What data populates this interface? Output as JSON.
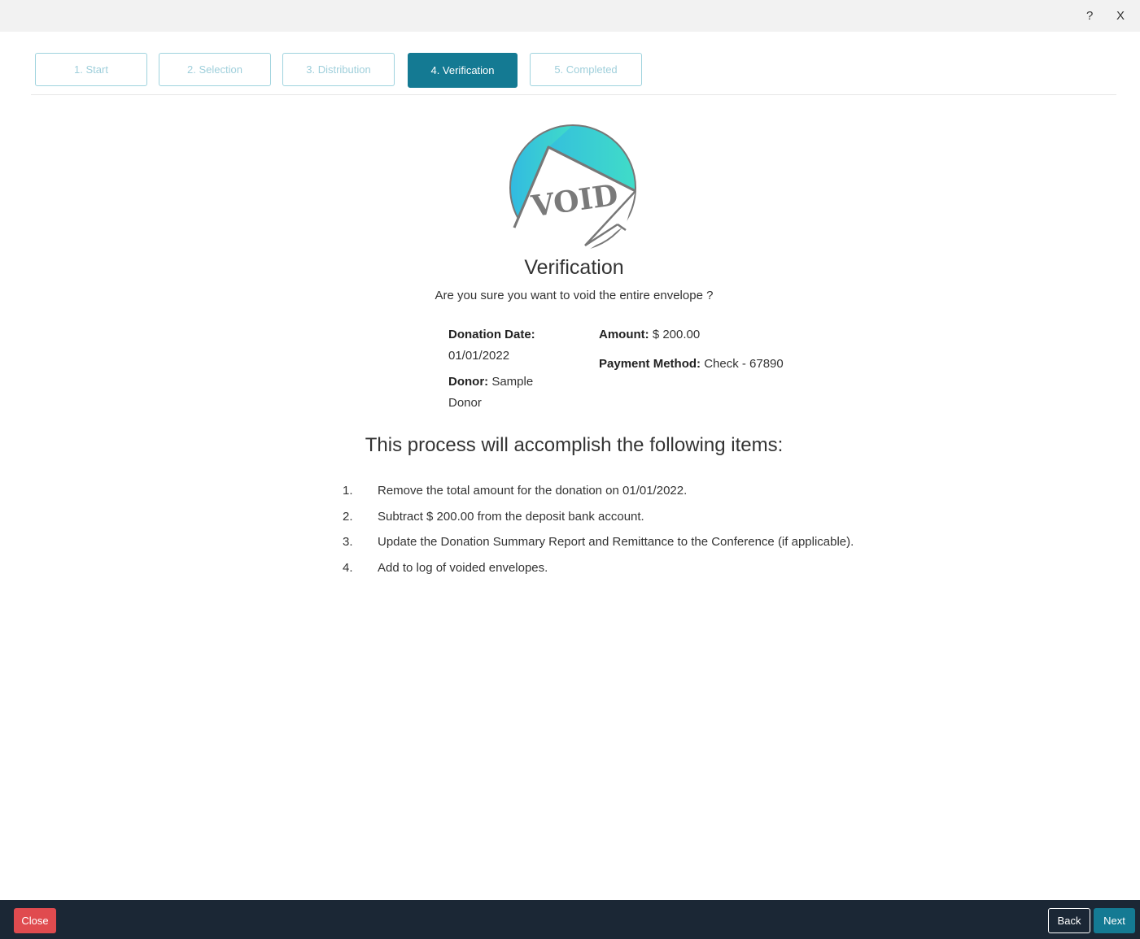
{
  "window": {
    "help_label": "?",
    "close_label": "X"
  },
  "steps": [
    {
      "label": "1. Start",
      "active": false
    },
    {
      "label": "2. Selection",
      "active": false
    },
    {
      "label": "3. Distribution",
      "active": false
    },
    {
      "label": "4. Verification",
      "active": true
    },
    {
      "label": "5. Completed",
      "active": false
    }
  ],
  "logo": {
    "stamp_text": "VOID",
    "icon": "void-envelope-icon"
  },
  "verification": {
    "title": "Verification",
    "question": "Are you sure you want to void the entire envelope ?"
  },
  "details": {
    "donation_date_label": "Donation Date:",
    "donation_date": "01/01/2022",
    "donor_label": "Donor:",
    "donor": "Sample Donor",
    "amount_label": "Amount:",
    "amount": "$ 200.00",
    "payment_method_label": "Payment Method:",
    "payment_method": "Check - 67890"
  },
  "process": {
    "title": "This process will accomplish the following items:",
    "items": [
      {
        "num": "1.",
        "text": "Remove the total amount for the donation on 01/01/2022."
      },
      {
        "num": "2.",
        "text": "Subtract $ 200.00 from the deposit bank account."
      },
      {
        "num": "3.",
        "text": "Update the Donation Summary Report and Remittance to the Conference (if applicable)."
      },
      {
        "num": "4.",
        "text": "Add to log of voided envelopes."
      }
    ]
  },
  "footer": {
    "close_label": "Close",
    "back_label": "Back",
    "next_label": "Next"
  },
  "colors": {
    "accent": "#147a93",
    "danger": "#e04b4f",
    "footer_bg": "#1b2735",
    "step_border": "#9fd3de"
  }
}
